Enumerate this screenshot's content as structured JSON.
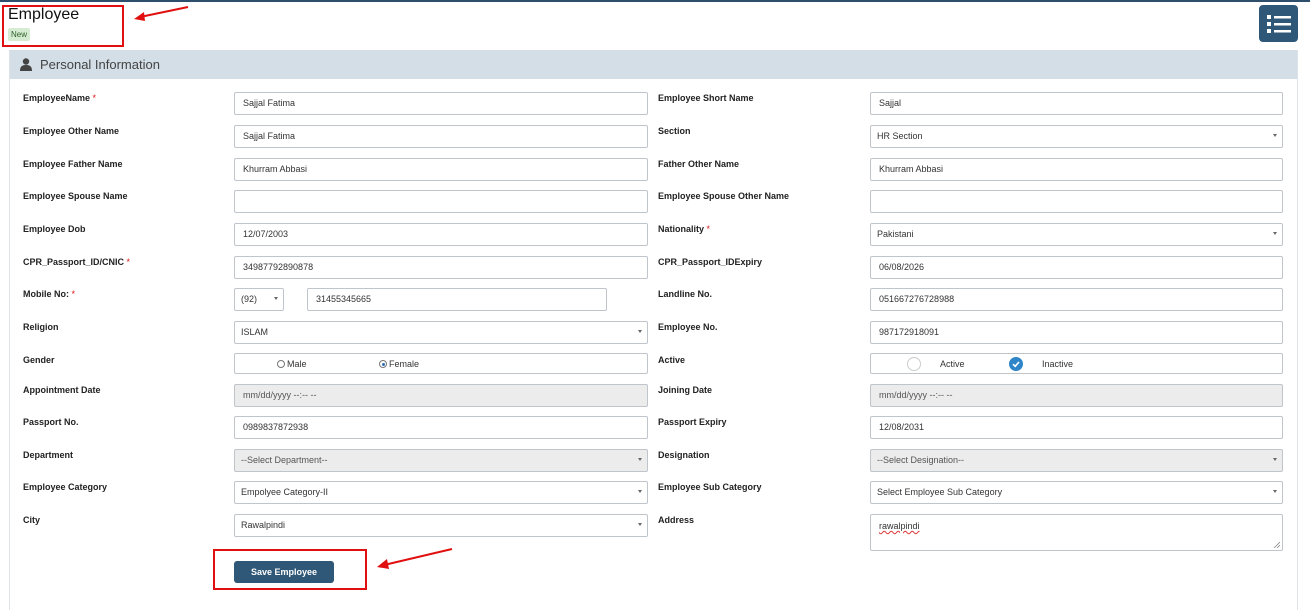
{
  "header": {
    "title": "Employee",
    "badge": "New"
  },
  "panel": {
    "title": "Personal Information"
  },
  "fields": {
    "employee_name": {
      "label": "EmployeeName",
      "value": "Sajjal Fatima",
      "required": "*"
    },
    "employee_short_name": {
      "label": "Employee Short Name",
      "value": "Sajjal"
    },
    "employee_other_name": {
      "label": "Employee Other Name",
      "value": "Sajjal Fatima"
    },
    "section": {
      "label": "Section",
      "value": "HR Section"
    },
    "father_name": {
      "label": "Employee Father Name",
      "value": "Khurram Abbasi"
    },
    "father_other_name": {
      "label": "Father Other Name",
      "value": "Khurram Abbasi"
    },
    "spouse_name": {
      "label": "Employee Spouse Name",
      "value": ""
    },
    "spouse_other_name": {
      "label": "Employee Spouse Other Name",
      "value": ""
    },
    "dob": {
      "label": "Employee Dob",
      "value": "12/07/2003"
    },
    "nationality": {
      "label": "Nationality",
      "value": "Pakistani",
      "required": "*"
    },
    "cnic": {
      "label": "CPR_Passport_ID/CNIC",
      "value": "34987792890878",
      "required": "*"
    },
    "id_expiry": {
      "label": "CPR_Passport_IDExpiry",
      "value": "06/08/2026"
    },
    "mobile": {
      "label": "Mobile No:",
      "code": "(92)",
      "value": "31455345665",
      "required": "*"
    },
    "landline": {
      "label": "Landline No.",
      "value": "051667276728988"
    },
    "religion": {
      "label": "Religion",
      "value": "ISLAM"
    },
    "employee_no": {
      "label": "Employee No.",
      "value": "987172918091"
    },
    "gender": {
      "label": "Gender",
      "option_male": "Male",
      "option_female": "Female",
      "selected": "Female"
    },
    "active": {
      "label": "Active",
      "option_active": "Active",
      "option_inactive": "Inactive",
      "selected": "Inactive"
    },
    "appointment_date": {
      "label": "Appointment Date",
      "value": "mm/dd/yyyy --:-- --"
    },
    "joining_date": {
      "label": "Joining Date",
      "value": "mm/dd/yyyy --:-- --"
    },
    "passport_no": {
      "label": "Passport No.",
      "value": "0989837872938"
    },
    "passport_expiry": {
      "label": "Passport Expiry",
      "value": "12/08/2031"
    },
    "department": {
      "label": "Department",
      "value": "--Select Department--"
    },
    "designation": {
      "label": "Designation",
      "value": "--Select Designation--"
    },
    "employee_category": {
      "label": "Employee Category",
      "value": "Empolyee Category-II"
    },
    "employee_sub_category": {
      "label": "Employee Sub Category",
      "value": "Select Employee Sub Category"
    },
    "city": {
      "label": "City",
      "value": "Rawalpindi"
    },
    "address": {
      "label": "Address",
      "value": "rawalpindi"
    }
  },
  "actions": {
    "save_label": "Save Employee"
  },
  "colors": {
    "primary": "#2f5777",
    "panel_header": "#d3dee7",
    "annotation": "#e01010",
    "required": "#dd1111"
  }
}
